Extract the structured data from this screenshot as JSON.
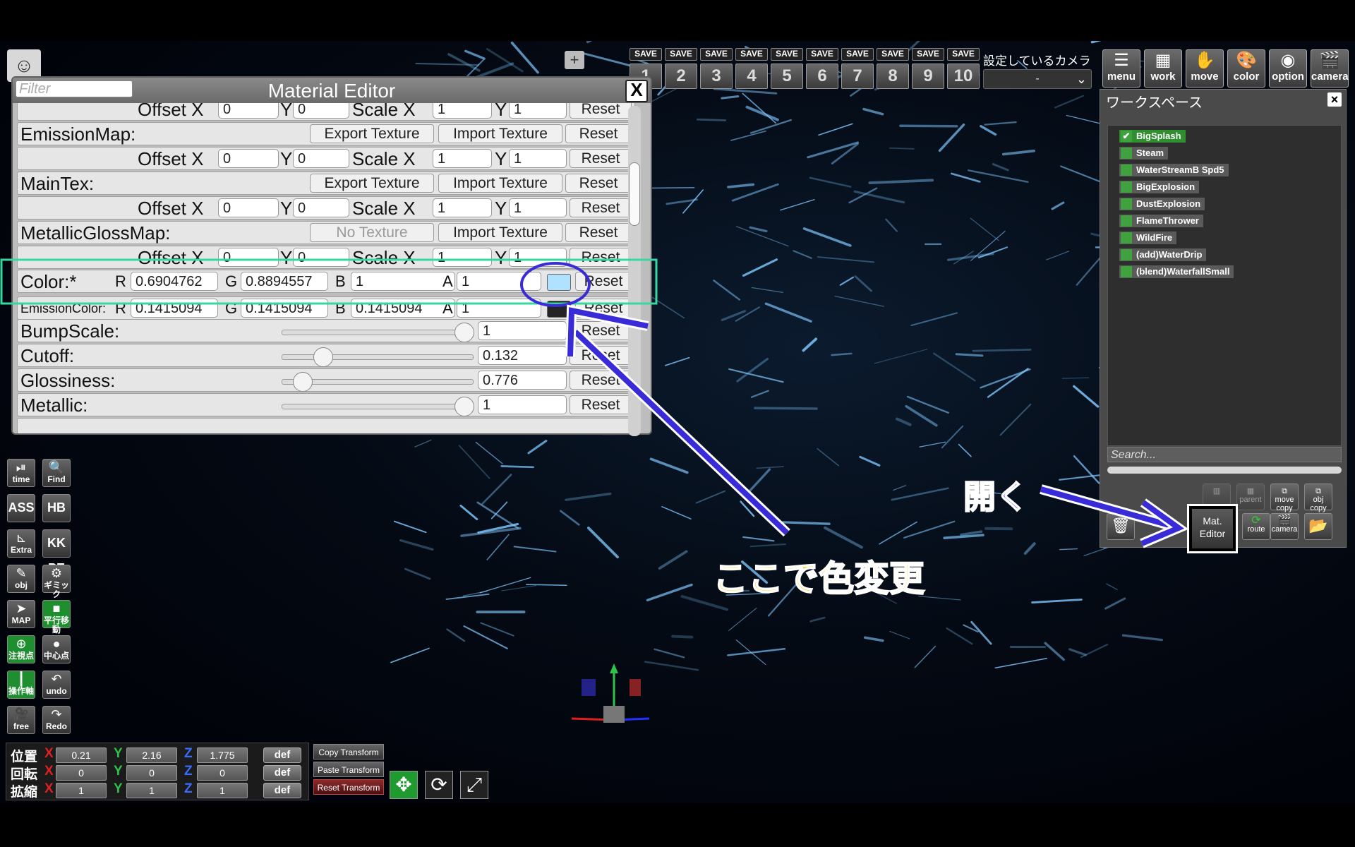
{
  "material_editor": {
    "title": "Material Editor",
    "filter_placeholder": "Filter",
    "close_label": "X",
    "texture_buttons": {
      "export": "Export Texture",
      "import": "Import Texture",
      "no_texture": "No Texture",
      "reset": "Reset"
    },
    "offset_labels": {
      "offset": "Offset X",
      "y": "Y",
      "scale": "Scale X",
      "sy": "Y"
    },
    "offset_values": {
      "ox": "0",
      "oy": "0",
      "sx": "1",
      "sy": "1"
    },
    "maps": [
      "EmissionMap:",
      "MainTex:",
      "MetallicGlossMap:"
    ],
    "color": {
      "label": "Color:*",
      "r": "0.6904762",
      "g": "0.8894557",
      "b": "1",
      "a": "1",
      "swatch": "#b0e2ff"
    },
    "emission_color": {
      "label": "EmissionColor:",
      "r": "0.1415094",
      "g": "0.1415094",
      "b": "0.1415094",
      "a": "1",
      "swatch": "#242424"
    },
    "color_channel_labels": {
      "r": "R",
      "g": "G",
      "b": "B",
      "a": "A"
    },
    "sliders": [
      {
        "label": "BumpScale:",
        "value": "1",
        "fraction": 1.0
      },
      {
        "label": "Cutoff:",
        "value": "0.132",
        "fraction": 0.18
      },
      {
        "label": "Glossiness:",
        "value": "0.776",
        "fraction": 0.06
      },
      {
        "label": "Metallic:",
        "value": "1",
        "fraction": 1.0
      }
    ]
  },
  "save_slots": {
    "label": "SAVE",
    "numbers": [
      "1",
      "2",
      "3",
      "4",
      "5",
      "6",
      "7",
      "8",
      "9",
      "10"
    ]
  },
  "camera": {
    "label": "設定しているカメラ",
    "value": "-"
  },
  "top_buttons": [
    {
      "label": "menu",
      "icon": "menu-icon"
    },
    {
      "label": "work",
      "icon": "work-icon"
    },
    {
      "label": "move",
      "icon": "hand-icon"
    },
    {
      "label": "color",
      "icon": "palette-icon"
    },
    {
      "label": "option",
      "icon": "eye-icon"
    },
    {
      "label": "camera",
      "icon": "clapper-icon"
    }
  ],
  "workspace": {
    "title": "ワークスペース",
    "close_label": "×",
    "items": [
      "BigSplash",
      "Steam",
      "WaterStreamB Spd5",
      "BigExplosion",
      "DustExplosion",
      "FlameThrower",
      "WildFire",
      "(add)WaterDrip",
      "(blend)WaterfallSmall"
    ],
    "search_placeholder": "Search...",
    "row1_buttons": [
      "",
      "parent",
      "move copy",
      "obj copy"
    ],
    "row2_buttons": [
      "route",
      "camera"
    ],
    "mat_editor_button": "Mat.\nEditor"
  },
  "left_toolbar": [
    {
      "label": "time",
      "icon": "play-pause-icon"
    },
    {
      "label": "Find",
      "icon": "search-icon"
    },
    {
      "label": "ASS",
      "icon": ""
    },
    {
      "label": "HB",
      "icon": ""
    },
    {
      "label": "Extra",
      "icon": "axes-icon"
    },
    {
      "label": "KK PE",
      "icon": ""
    },
    {
      "label": "obj",
      "icon": "edit-icon"
    },
    {
      "label": "ギミック",
      "icon": "gear-icon"
    },
    {
      "label": "MAP",
      "icon": "map-icon"
    },
    {
      "label": "平行移動",
      "icon": "square-icon"
    },
    {
      "label": "注視点",
      "icon": "crosshair-icon"
    },
    {
      "label": "中心点",
      "icon": "dot-icon"
    },
    {
      "label": "操作軸",
      "icon": "axis-icon"
    },
    {
      "label": "undo",
      "icon": "undo-icon"
    },
    {
      "label": "free",
      "icon": "video-icon"
    },
    {
      "label": "Redo",
      "icon": "redo-icon"
    }
  ],
  "transform": {
    "rows": [
      {
        "label": "位置",
        "x": "0.21",
        "y": "2.16",
        "z": "1.775"
      },
      {
        "label": "回転",
        "x": "0",
        "y": "0",
        "z": "0"
      },
      {
        "label": "拡縮",
        "x": "1",
        "y": "1",
        "z": "1"
      }
    ],
    "axes": {
      "x": "X",
      "y": "Y",
      "z": "Z"
    },
    "def_label": "def",
    "buttons": [
      "Copy Transform",
      "Paste Transform",
      "Reset Transform"
    ]
  },
  "annotations": {
    "open": "開く",
    "change_color": "ここで色変更"
  },
  "accent_colors": {
    "annotation_arrow": "#3a2bd8",
    "annotation_text": "#ffd21a",
    "highlight_box": "#3ad6a0"
  }
}
